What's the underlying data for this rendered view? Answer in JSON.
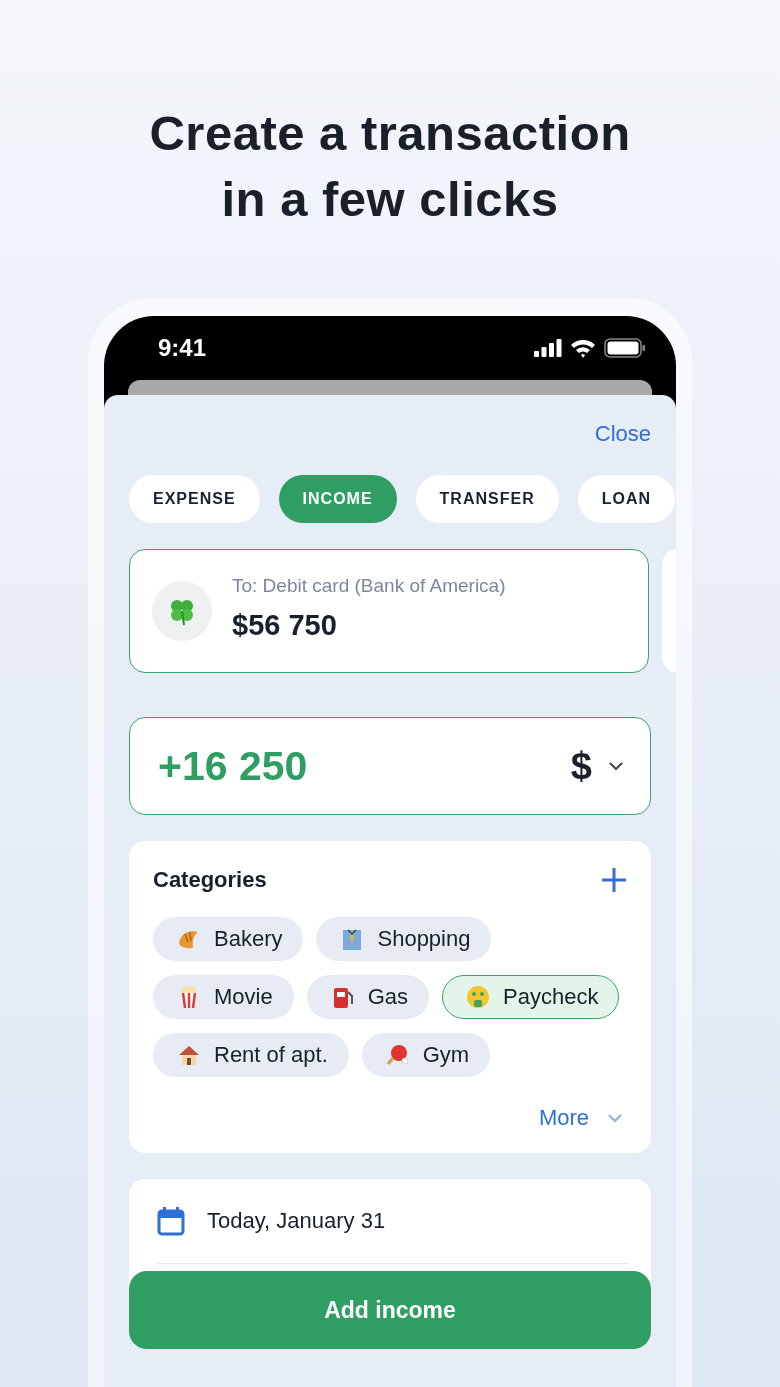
{
  "headline_lines": [
    "Create a transaction",
    "in a few clicks"
  ],
  "status_bar": {
    "time": "9:41"
  },
  "close": "Close",
  "tabs": [
    {
      "label": "EXPENSE",
      "selected": false
    },
    {
      "label": "INCOME",
      "selected": true
    },
    {
      "label": "TRANSFER",
      "selected": false
    },
    {
      "label": "LOAN",
      "selected": false
    }
  ],
  "account": {
    "label": "To: Debit card (Bank of America)",
    "balance": "$56 750"
  },
  "amount": {
    "value": "+16 250",
    "currency": "$"
  },
  "categories": {
    "title": "Categories",
    "items": [
      {
        "label": "Bakery",
        "selected": false
      },
      {
        "label": "Shopping",
        "selected": false
      },
      {
        "label": "Movie",
        "selected": false
      },
      {
        "label": "Gas",
        "selected": false
      },
      {
        "label": "Paycheck",
        "selected": true
      },
      {
        "label": "Rent of apt.",
        "selected": false
      },
      {
        "label": "Gym",
        "selected": false
      }
    ],
    "more": "More"
  },
  "date": "Today, January 31",
  "submit": "Add income"
}
